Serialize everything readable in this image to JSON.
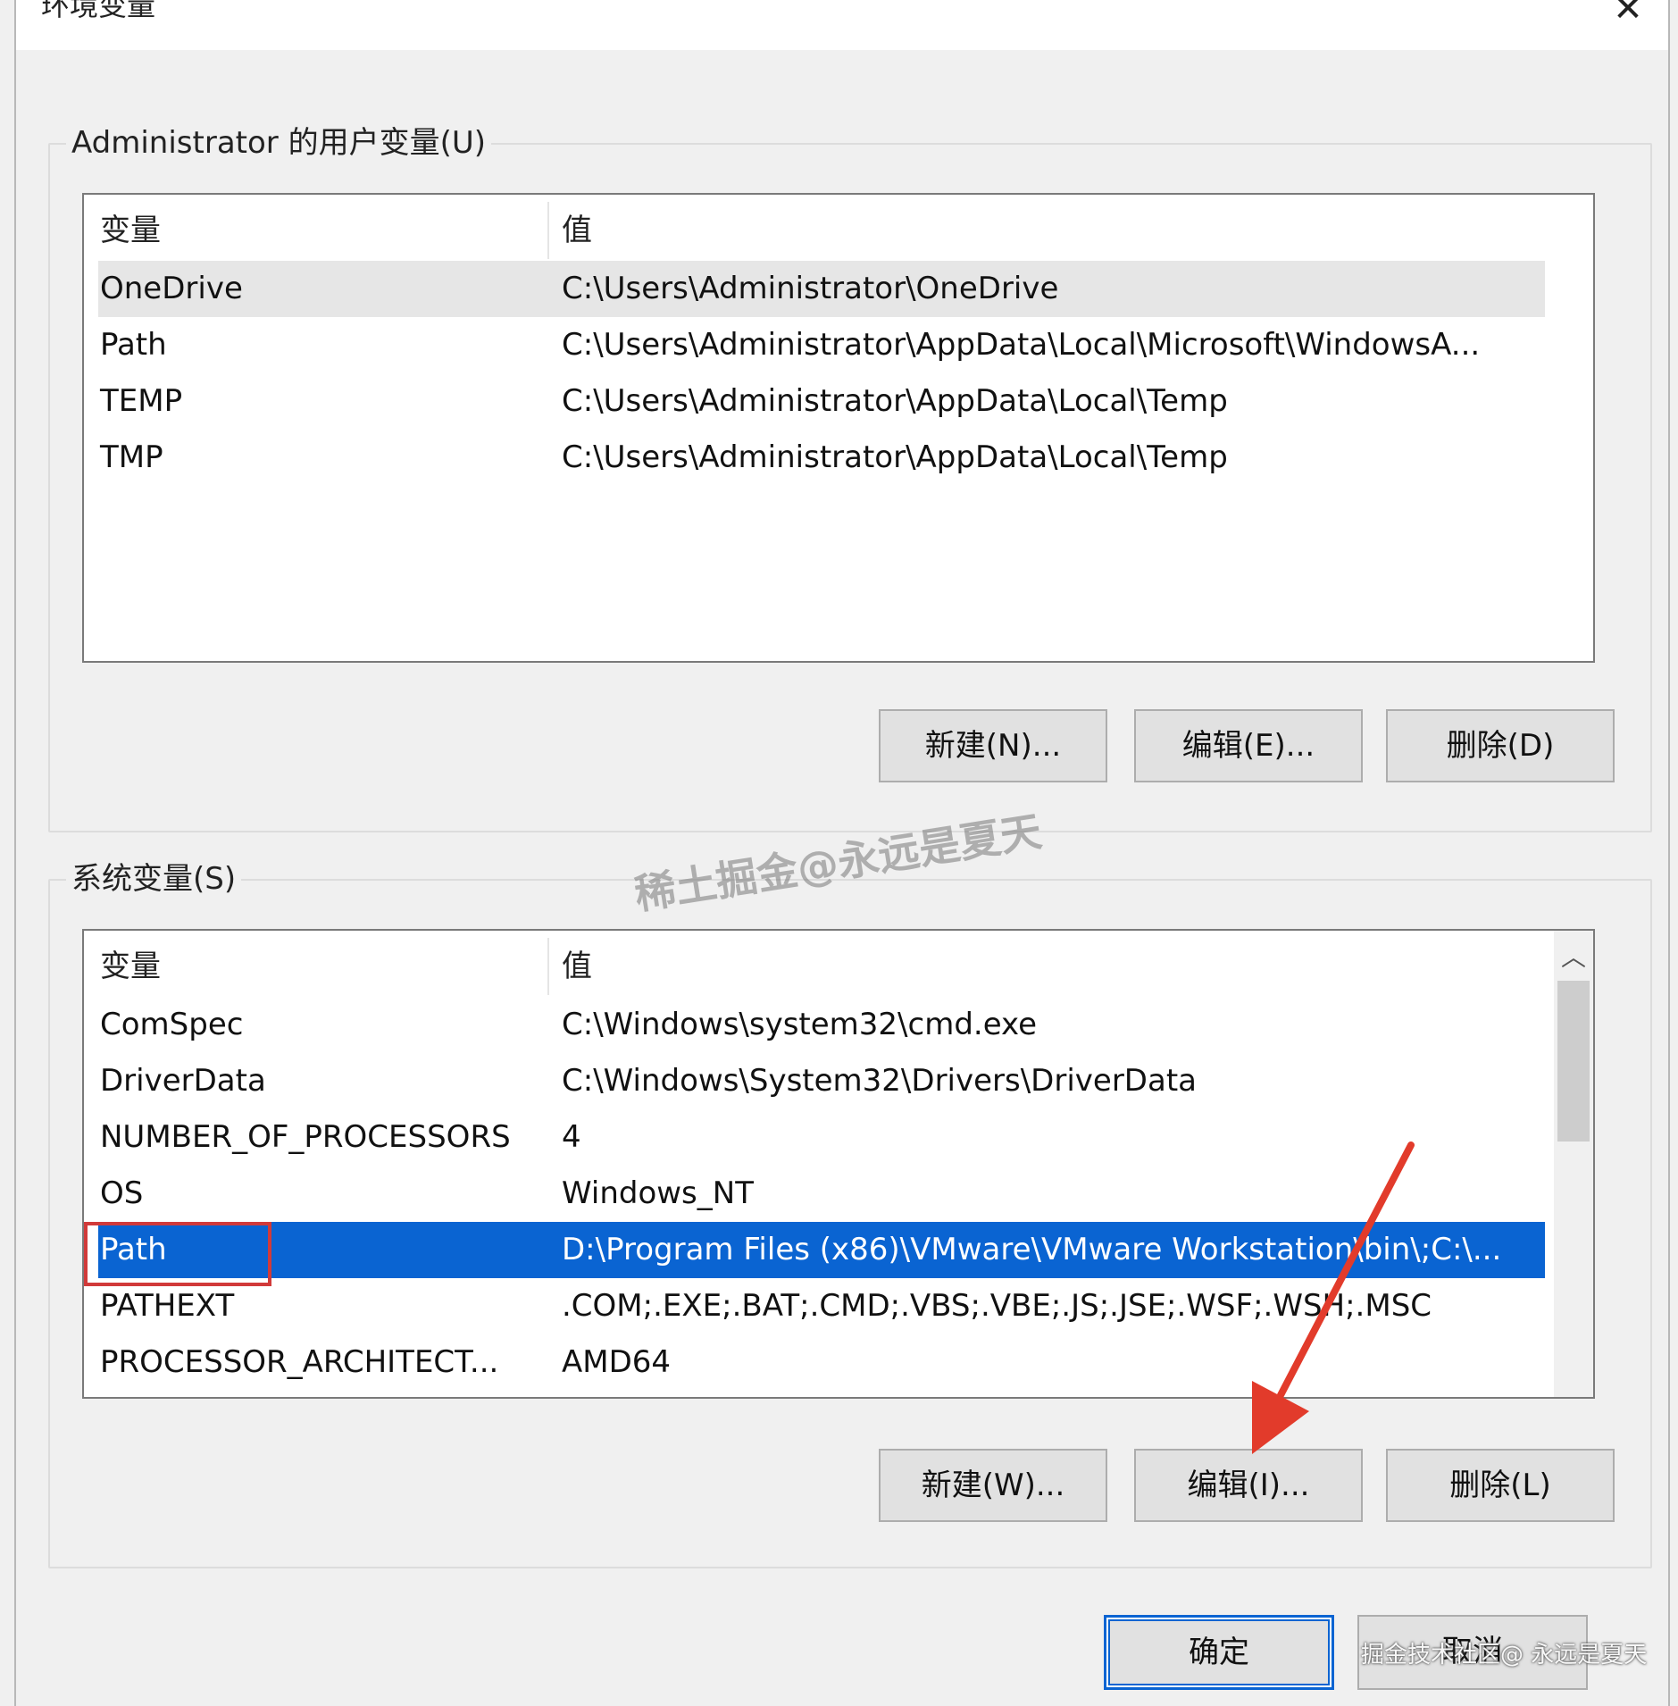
{
  "window": {
    "title": "环境变量",
    "close_glyph": "✕"
  },
  "user_vars": {
    "group_label": "Administrator 的用户变量(U)",
    "columns": [
      "变量",
      "值"
    ],
    "rows": [
      {
        "name": "OneDrive",
        "value": "C:\\Users\\Administrator\\OneDrive"
      },
      {
        "name": "Path",
        "value": "C:\\Users\\Administrator\\AppData\\Local\\Microsoft\\WindowsA..."
      },
      {
        "name": "TEMP",
        "value": "C:\\Users\\Administrator\\AppData\\Local\\Temp"
      },
      {
        "name": "TMP",
        "value": "C:\\Users\\Administrator\\AppData\\Local\\Temp"
      }
    ],
    "buttons": {
      "new": "新建(N)...",
      "edit": "编辑(E)...",
      "delete": "删除(D)"
    }
  },
  "system_vars": {
    "group_label": "系统变量(S)",
    "columns": [
      "变量",
      "值"
    ],
    "rows": [
      {
        "name": "ComSpec",
        "value": "C:\\Windows\\system32\\cmd.exe"
      },
      {
        "name": "DriverData",
        "value": "C:\\Windows\\System32\\Drivers\\DriverData"
      },
      {
        "name": "NUMBER_OF_PROCESSORS",
        "value": "4"
      },
      {
        "name": "OS",
        "value": "Windows_NT"
      },
      {
        "name": "Path",
        "value": "D:\\Program Files (x86)\\VMware\\VMware Workstation\\bin\\;C:\\..."
      },
      {
        "name": "PATHEXT",
        "value": ".COM;.EXE;.BAT;.CMD;.VBS;.VBE;.JS;.JSE;.WSF;.WSH;.MSC"
      },
      {
        "name": "PROCESSOR_ARCHITECT...",
        "value": "AMD64"
      }
    ],
    "selected_row": "Path",
    "buttons": {
      "new": "新建(W)...",
      "edit": "编辑(I)...",
      "delete": "删除(L)"
    }
  },
  "footer": {
    "ok": "确定",
    "cancel": "取消"
  },
  "watermarks": {
    "center": "稀土掘金@永远是夏天",
    "corner": "掘金技术社区@ 永远是夏天"
  },
  "colors": {
    "selection": "#0a64d2",
    "highlight_box": "#d13a3a",
    "arrow": "#e23b2b"
  },
  "icons": {
    "scroll_up": "chevron-up-icon",
    "close": "close-icon"
  }
}
